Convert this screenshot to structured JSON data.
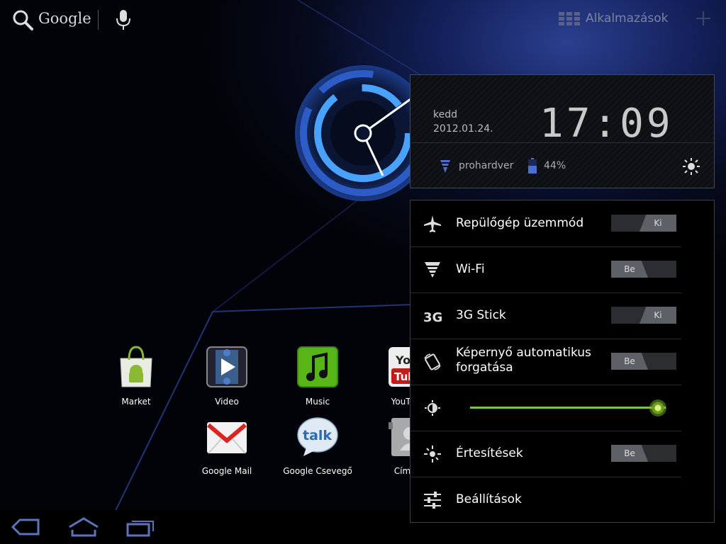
{
  "topbar": {
    "search_label": "Google",
    "apps_label": "Alkalmazások"
  },
  "apps": [
    {
      "label": "Market",
      "icon": "market-icon"
    },
    {
      "label": "Video",
      "icon": "video-icon"
    },
    {
      "label": "Music",
      "icon": "music-icon"
    },
    {
      "label": "YouTube",
      "icon": "youtube-icon"
    },
    {
      "label": "Google Mail",
      "icon": "gmail-icon"
    },
    {
      "label": "Google Csevegő",
      "icon": "talk-icon"
    },
    {
      "label": "Címtár",
      "icon": "contacts-icon"
    }
  ],
  "quick_settings": {
    "day": "kedd",
    "date": "2012.01.24.",
    "time": "17:09",
    "network": "prohardver",
    "battery": "44%",
    "items": [
      {
        "label": "Repülőgép üzemmód",
        "state": "Ki",
        "icon": "airplane-icon"
      },
      {
        "label": "Wi-Fi",
        "state": "Be",
        "icon": "wifi-icon"
      },
      {
        "label": "3G Stick",
        "state": "Ki",
        "icon": "3g-icon"
      },
      {
        "label": "Képernyő automatikus forgatása",
        "state": "Be",
        "icon": "rotate-icon"
      },
      {
        "label": "",
        "state": "",
        "icon": "brightness-auto-icon",
        "level": 0.96
      },
      {
        "label": "Értesítések",
        "state": "Be",
        "icon": "notification-icon"
      },
      {
        "label": "Beállítások",
        "state": "",
        "icon": "settings-sliders-icon"
      }
    ]
  },
  "colors": {
    "accent_green": "#7cc43d",
    "clock_blue": "#3a8fff"
  }
}
